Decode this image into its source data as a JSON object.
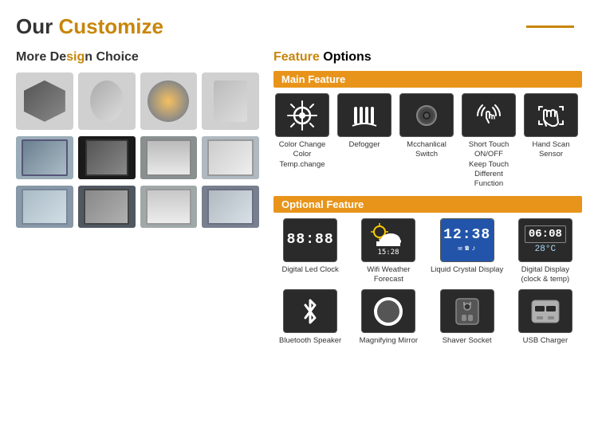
{
  "header": {
    "title_our": "Our ",
    "title_customize": "Customize"
  },
  "left": {
    "section_title_more": "More De",
    "section_title_sign": "sign",
    "section_title_choice": " Choice",
    "design_shapes": [
      "hexagon",
      "oval",
      "circle",
      "rectangle"
    ],
    "design_rows": [
      [
        "rect1",
        "rect2",
        "rect3",
        "rect4"
      ],
      [
        "rect5",
        "rect6",
        "rect7",
        "rect8"
      ]
    ]
  },
  "right": {
    "section_title_feature": "Feature",
    "section_title_options": " Options",
    "main_feature_label": "Main Feature",
    "main_features": [
      {
        "icon": "color-change",
        "label": "Color Change\nColor Temp.change"
      },
      {
        "icon": "defogger",
        "label": "Defogger"
      },
      {
        "icon": "mechanical-switch",
        "label": "Mechanical\nSwitch"
      },
      {
        "icon": "touch-switch",
        "label": "Short Touch ON/OFF\nKeep Touch Different\nFunction"
      },
      {
        "icon": "hand-scan",
        "label": "Hand Scan Sensor"
      }
    ],
    "optional_feature_label": "Optional Feature",
    "optional_features": [
      {
        "icon": "digital-led-clock",
        "label": "Digital Led Clock"
      },
      {
        "icon": "wifi-weather",
        "label": "Wifi Weather Forecast"
      },
      {
        "icon": "lcd",
        "label": "Liquid Crystal Display"
      },
      {
        "icon": "digital-display",
        "label": "Digital Display\n(clock & temp)"
      },
      {
        "icon": "bluetooth",
        "label": "Bluetooth Speaker"
      },
      {
        "icon": "magnifying",
        "label": "Magnifying Mirror"
      },
      {
        "icon": "shaver",
        "label": "Shaver Socket"
      },
      {
        "icon": "usb",
        "label": "USB Charger"
      }
    ]
  }
}
